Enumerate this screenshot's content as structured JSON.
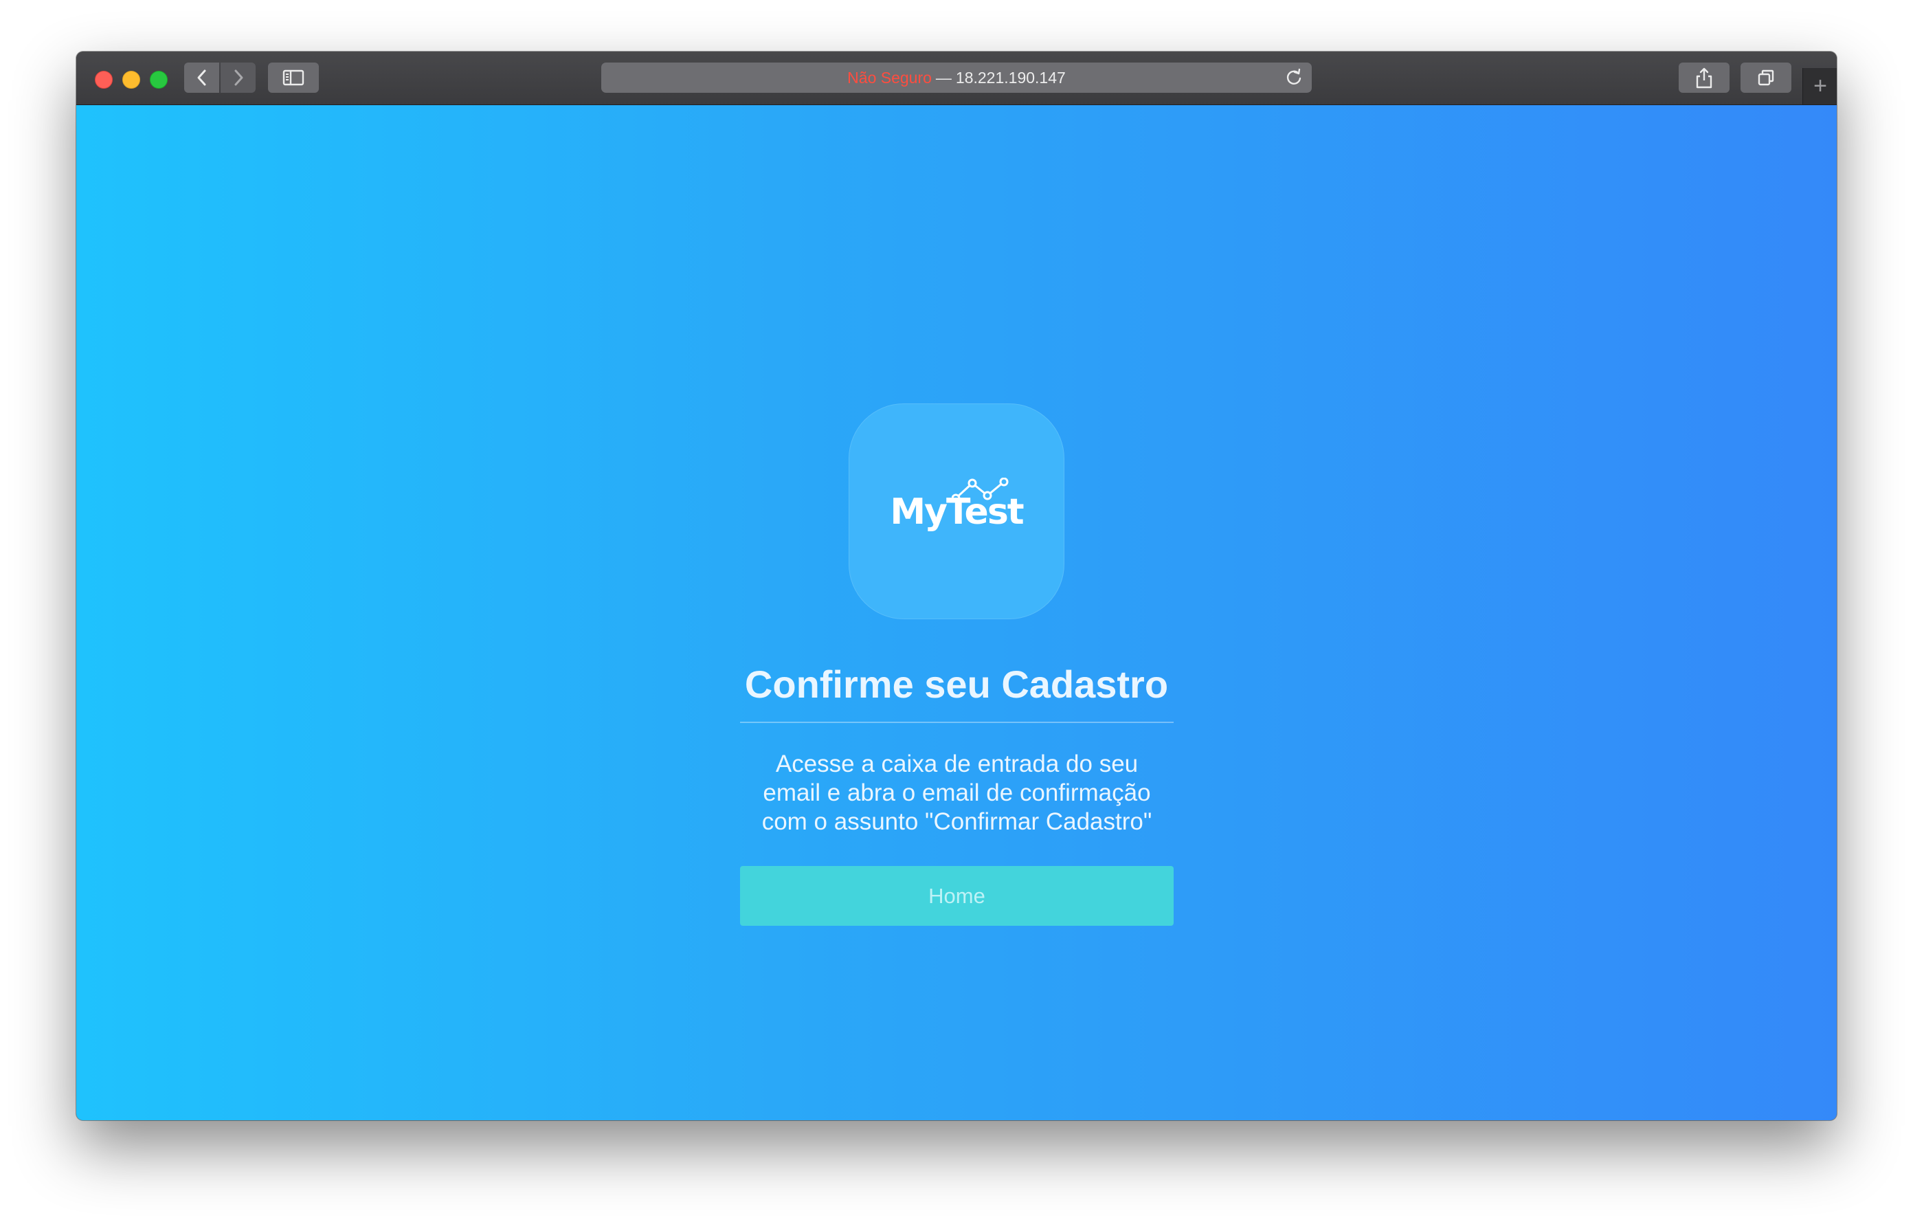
{
  "browser": {
    "address": {
      "security_label": "Não Seguro",
      "separator": "—",
      "host": "18.221.190.147"
    },
    "new_tab_symbol": "+"
  },
  "icons": {
    "back": "chevron-left-icon",
    "forward": "chevron-right-icon",
    "sidebar": "sidebar-icon",
    "reload": "reload-icon",
    "share": "share-icon",
    "tabs": "tab-overview-icon"
  },
  "colors": {
    "gradient_start": "#1fc2fd",
    "gradient_end": "#3489f9",
    "button": "#43d4dc",
    "insecure": "#ff4d3f"
  },
  "page": {
    "logo_text": "MyTest",
    "title": "Confirme seu Cadastro",
    "message_lines": [
      "Acesse a caixa de entrada do seu",
      "email e abra o email de confirmação",
      "com o assunto \"Confirmar Cadastro\""
    ],
    "home_button_label": "Home"
  }
}
